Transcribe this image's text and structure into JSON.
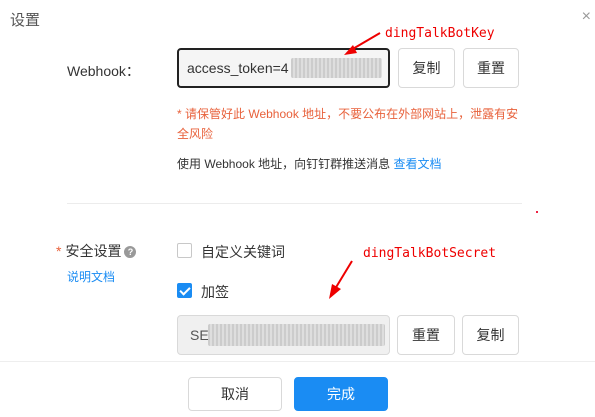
{
  "dialog": {
    "title": "设置",
    "close_glyph": "×"
  },
  "webhook": {
    "label": "Webhook：",
    "value_visible": "access_token=4",
    "copy_label": "复制",
    "reset_label": "重置",
    "warning": "* 请保管好此 Webhook 地址，不要公布在外部网站上，泄露有安全风险",
    "note": "使用 Webhook 地址，向钉钉群推送消息",
    "doc_link": "查看文档"
  },
  "security": {
    "required_mark": "*",
    "label": "安全设置",
    "help_glyph": "?",
    "doc_link": "说明文档",
    "custom_keyword_label": "自定义关键词",
    "custom_keyword_checked": false,
    "sign_label": "加签",
    "sign_checked": true,
    "secret_visible": "SE",
    "reset_label": "重置",
    "copy_label": "复制"
  },
  "annotations": {
    "key_label": "dingTalkBotKey",
    "secret_label": "dingTalkBotSecret",
    "color": "#ee0000"
  },
  "footer": {
    "cancel_label": "取消",
    "done_label": "完成"
  },
  "colors": {
    "primary": "#1a8cf3",
    "warning": "#e8613b"
  }
}
